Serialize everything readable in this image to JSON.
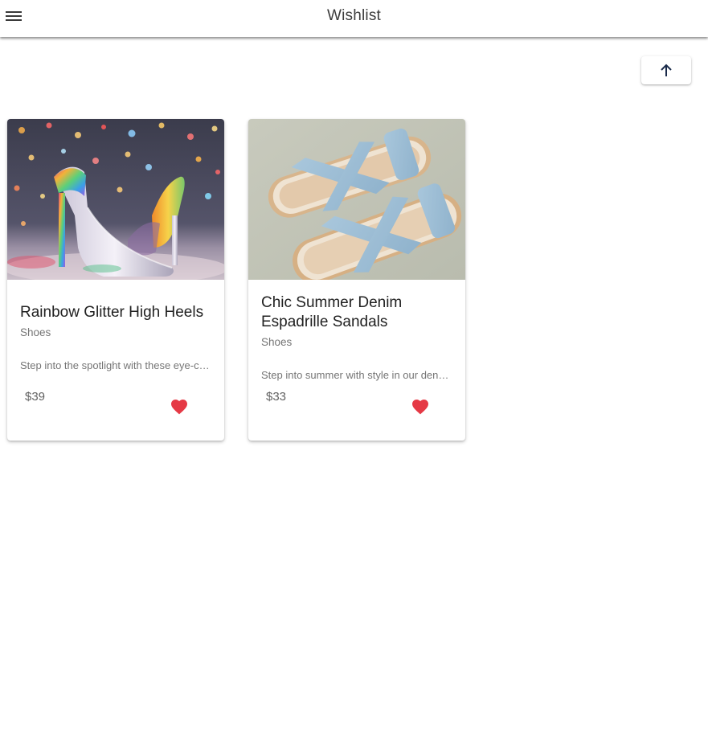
{
  "header": {
    "title": "Wishlist",
    "menu_icon": "hamburger-menu-icon"
  },
  "scroll_top": {
    "icon": "arrow-up-icon",
    "color": "#1a2a4a"
  },
  "colors": {
    "accent_heart": "#e53945",
    "title_text": "#3c3c3c",
    "secondary_text": "#757575"
  },
  "products": [
    {
      "title": "Rainbow Glitter High Heels",
      "category": "Shoes",
      "description": "Step into the spotlight with these eye-catching",
      "price": "$39",
      "favorite_icon": "heart-filled-icon"
    },
    {
      "title": "Chic Summer Denim Espadrille Sandals",
      "category": "Shoes",
      "description": "Step into summer with style in our denim espadrille sandals",
      "price": "$33",
      "favorite_icon": "heart-filled-icon"
    }
  ]
}
